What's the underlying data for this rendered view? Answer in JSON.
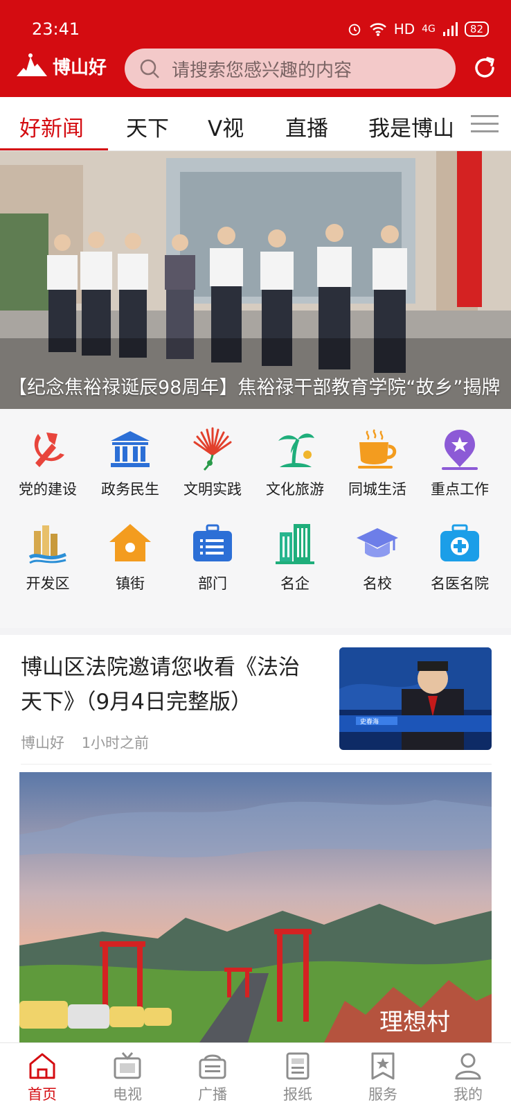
{
  "status_bar": {
    "time": "23:41",
    "network": "HD",
    "signal": "4G",
    "battery": "82"
  },
  "header": {
    "logo_text": "博山好",
    "search_placeholder": "请搜索您感兴趣的内容"
  },
  "tabs": [
    {
      "label": "好新闻",
      "active": true
    },
    {
      "label": "天下"
    },
    {
      "label": "V视"
    },
    {
      "label": "直播"
    },
    {
      "label": "我是博山"
    }
  ],
  "hero": {
    "caption": "【纪念焦裕禄诞辰98周年】焦裕禄干部教育学院“故乡”揭牌"
  },
  "grid": [
    {
      "label": "党的建设",
      "icon": "party-icon"
    },
    {
      "label": "政务民生",
      "icon": "government-icon"
    },
    {
      "label": "文明实践",
      "icon": "civilization-icon"
    },
    {
      "label": "文化旅游",
      "icon": "travel-icon"
    },
    {
      "label": "同城生活",
      "icon": "coffee-icon"
    },
    {
      "label": "重点工作",
      "icon": "location-icon"
    },
    {
      "label": "开发区",
      "icon": "district-icon"
    },
    {
      "label": "镇街",
      "icon": "house-icon"
    },
    {
      "label": "部门",
      "icon": "briefcase-icon"
    },
    {
      "label": "名企",
      "icon": "building-icon"
    },
    {
      "label": "名校",
      "icon": "graduation-icon"
    },
    {
      "label": "名医名院",
      "icon": "medical-icon"
    }
  ],
  "news": {
    "title": "博山区法院邀请您收看《法治天下》（9月4日完整版）",
    "source": "博山好",
    "time": "1小时之前",
    "thumb_caption": "史春海",
    "banner_text": "理想村"
  },
  "bottom_nav": [
    {
      "label": "首页",
      "icon": "home-icon",
      "active": true
    },
    {
      "label": "电视",
      "icon": "tv-icon"
    },
    {
      "label": "广播",
      "icon": "radio-icon"
    },
    {
      "label": "报纸",
      "icon": "newspaper-icon"
    },
    {
      "label": "服务",
      "icon": "service-icon"
    },
    {
      "label": "我的",
      "icon": "profile-icon"
    }
  ]
}
